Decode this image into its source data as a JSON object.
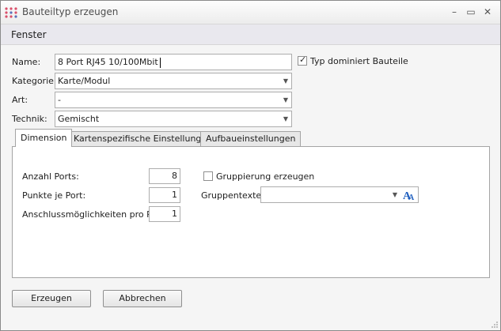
{
  "window": {
    "title": "Bauteiltyp erzeugen",
    "minimize_glyph": "–",
    "maximize_glyph": "▭",
    "close_glyph": "✕",
    "icon": "app-dots-icon"
  },
  "menu": {
    "fenster": "Fenster"
  },
  "form": {
    "name_label": "Name:",
    "name_value": "8 Port RJ45 10/100Mbit",
    "dominates_label": "Typ dominiert Bauteile",
    "dominates_checked": true,
    "kategorie_label": "Kategorie:",
    "kategorie_value": "Karte/Modul",
    "art_label": "Art:",
    "art_value": "-",
    "technik_label": "Technik:",
    "technik_value": "Gemischt"
  },
  "tabs": [
    {
      "label": "Dimension",
      "active": true
    },
    {
      "label": "Kartenspezifische Einstellungen",
      "active": false
    },
    {
      "label": "Aufbaueinstellungen",
      "active": false
    }
  ],
  "dimension": {
    "ports_label": "Anzahl Ports:",
    "ports_value": "8",
    "punkte_label": "Punkte je Port:",
    "punkte_value": "1",
    "anschluss_label": "Anschlussmöglichkeiten pro Port:",
    "anschluss_value": "1",
    "gruppierung_label": "Gruppierung erzeugen",
    "gruppierung_checked": false,
    "gruppentexte_label": "Gruppentexte:",
    "gruppentexte_value": ""
  },
  "buttons": {
    "create": "Erzeugen",
    "cancel": "Abbrechen"
  },
  "colors": {
    "accent_blue": "#1f5fbf",
    "icon_red": "#d9534f"
  }
}
